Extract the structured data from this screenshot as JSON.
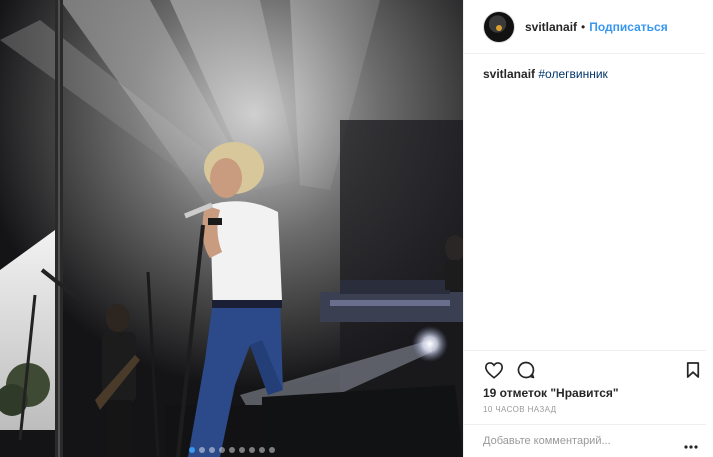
{
  "post": {
    "username": "svitlanaif",
    "separator": "•",
    "follow_label": "Подписаться",
    "caption_user": "svitlanaif",
    "caption_hashtag": "#олегвинник",
    "likes_text": "19 отметок \"Нравится\"",
    "time_text": "10 часов назад",
    "comment_placeholder": "Добавьте комментарий..."
  },
  "carousel": {
    "count": 9,
    "active_index": 0
  },
  "colors": {
    "link": "#3897f0",
    "hashtag": "#003569",
    "muted": "#999999",
    "border": "#efefef"
  },
  "icons": [
    "heart-icon",
    "comment-icon",
    "bookmark-icon",
    "more-options-icon"
  ]
}
